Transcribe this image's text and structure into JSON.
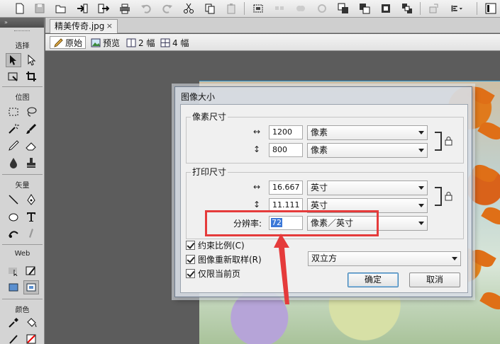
{
  "toolbar": {
    "icons": [
      "new-icon",
      "save-icon",
      "open-icon",
      "import-icon",
      "export-icon",
      "print-icon",
      "undo-icon",
      "redo-icon",
      "cut-icon",
      "copy-icon",
      "paste-icon",
      "group-icon",
      "ungroup-icon",
      "join-icon",
      "split-icon",
      "arrange-front-icon",
      "arrange-forward-icon",
      "arrange-backward-icon",
      "arrange-back-icon",
      "rotate-icon",
      "align-icon",
      "panel-icon"
    ]
  },
  "tools": {
    "sections": {
      "select": "选择",
      "bitmap": "位图",
      "vector": "矢量",
      "web": "Web",
      "color": "颜色"
    }
  },
  "document": {
    "tab_label": "精美传奇.jpg",
    "close_symbol": "×"
  },
  "view_bar": {
    "original": "原始",
    "preview": "预览",
    "two_up": "2 幅",
    "four_up": "4 幅"
  },
  "dialog": {
    "title": "图像大小",
    "pixel_group": {
      "title": "像素尺寸",
      "width_icon": "↔",
      "height_icon": "↕",
      "width_value": "1200",
      "height_value": "800",
      "width_unit": "像素",
      "height_unit": "像素"
    },
    "print_group": {
      "title": "打印尺寸",
      "width_icon": "↔",
      "height_icon": "↕",
      "width_value": "16.667",
      "height_value": "11.111",
      "width_unit": "英寸",
      "height_unit": "英寸",
      "resolution_label": "分辨率:",
      "resolution_value": "72",
      "resolution_unit": "像素／英寸"
    },
    "checkboxes": {
      "constrain": "约束比例(C)",
      "resample": "图像重新取样(R)",
      "current_page": "仅限当前页"
    },
    "resample_method": "双立方",
    "ok": "确定",
    "cancel": "取消"
  },
  "colors": {
    "annotation": "#e53b3b",
    "selection": "#2b9ad8"
  }
}
